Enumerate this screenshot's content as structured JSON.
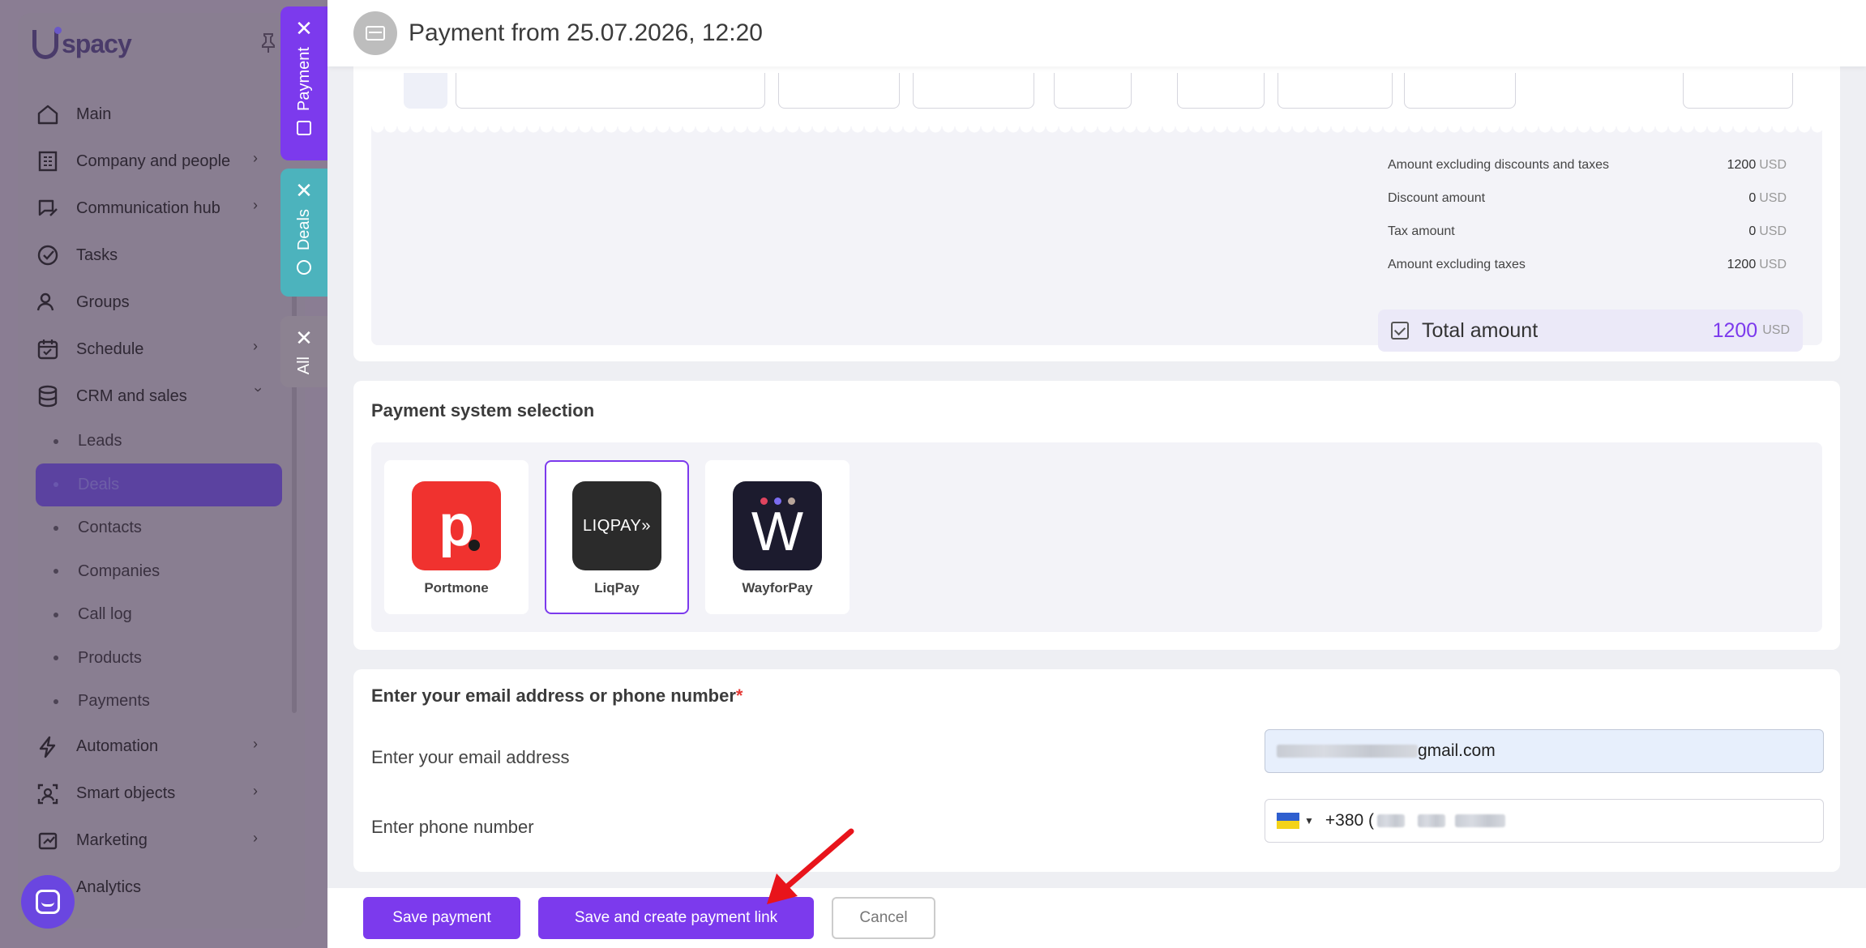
{
  "app": {
    "logo_text": "spacy",
    "logo_prefix": "U"
  },
  "sidebar": {
    "items": [
      {
        "label": "Main",
        "icon": "home-icon",
        "chevron": false
      },
      {
        "label": "Company and people",
        "icon": "building-icon",
        "chevron": true
      },
      {
        "label": "Communication hub",
        "icon": "chat-edit-icon",
        "chevron": true
      },
      {
        "label": "Tasks",
        "icon": "check-circle-icon",
        "chevron": false
      },
      {
        "label": "Groups",
        "icon": "users-icon",
        "chevron": false
      },
      {
        "label": "Schedule",
        "icon": "calendar-icon",
        "chevron": true
      },
      {
        "label": "CRM and sales",
        "icon": "database-icon",
        "chevron": "down"
      }
    ],
    "crm_subitems": [
      {
        "label": "Leads",
        "active": false
      },
      {
        "label": "Deals",
        "active": true
      },
      {
        "label": "Contacts",
        "active": false
      },
      {
        "label": "Companies",
        "active": false
      },
      {
        "label": "Call log",
        "active": false
      },
      {
        "label": "Products",
        "active": false
      },
      {
        "label": "Payments",
        "active": false
      }
    ],
    "bottom_items": [
      {
        "label": "Automation",
        "icon": "lightning-icon",
        "chevron": true
      },
      {
        "label": "Smart objects",
        "icon": "smart-object-icon",
        "chevron": true
      },
      {
        "label": "Marketing",
        "icon": "marketing-icon",
        "chevron": true
      },
      {
        "label": "Analytics",
        "icon": "analytics-icon",
        "chevron": false
      }
    ]
  },
  "vertical_tabs": [
    {
      "label": "Payment",
      "color": "#7c3aed"
    },
    {
      "label": "Deals",
      "color": "#4cb3bd"
    },
    {
      "label": "All",
      "color": "#8c8291"
    }
  ],
  "header": {
    "title": "Payment from 25.07.2026, 12:20"
  },
  "summary": {
    "rows": [
      {
        "label": "Amount excluding discounts and taxes",
        "value": "1200",
        "currency": "USD"
      },
      {
        "label": "Discount amount",
        "value": "0",
        "currency": "USD"
      },
      {
        "label": "Tax amount",
        "value": "0",
        "currency": "USD"
      },
      {
        "label": "Amount excluding taxes",
        "value": "1200",
        "currency": "USD"
      }
    ],
    "total": {
      "label": "Total amount",
      "value": "1200",
      "currency": "USD"
    }
  },
  "payment_systems": {
    "title": "Payment system selection",
    "options": [
      {
        "name": "Portmone",
        "logo_text": "p",
        "selected": false
      },
      {
        "name": "LiqPay",
        "logo_text": "LIQPAY»",
        "selected": true
      },
      {
        "name": "WayforPay",
        "logo_text": "W",
        "selected": false
      }
    ]
  },
  "contact": {
    "title": "Enter your email address or phone number",
    "required_mark": "*",
    "email_label": "Enter your email address",
    "email_value": "gmail.com",
    "phone_label": "Enter phone number",
    "phone_prefix": "+380 ("
  },
  "footer": {
    "save_label": "Save payment",
    "save_link_label": "Save and create payment link",
    "cancel_label": "Cancel"
  },
  "colors": {
    "accent": "#7c3aed",
    "deals_tab": "#4cb3bd",
    "annotation_arrow": "#e8141b"
  }
}
